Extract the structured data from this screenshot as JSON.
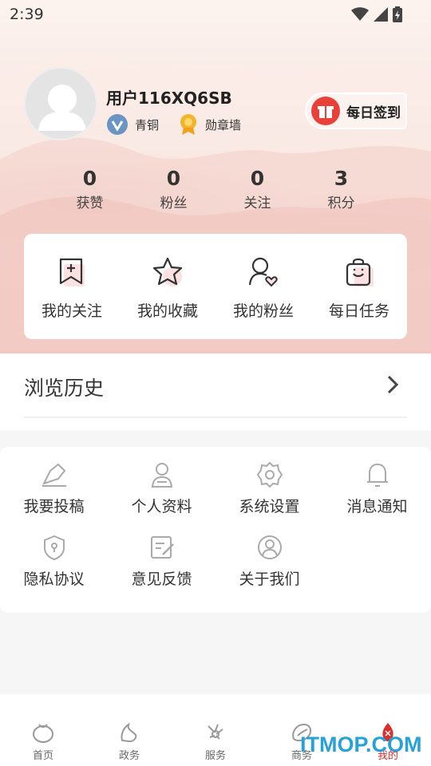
{
  "status_bar": {
    "time": "2:39",
    "icons": [
      "wifi-icon",
      "signal-icon",
      "battery-icon"
    ]
  },
  "profile": {
    "username": "用户116XQ6SB",
    "level": "青铜",
    "medal": "勋章墙",
    "checkin_label": "每日签到"
  },
  "stats": [
    {
      "value": "0",
      "label": "获赞"
    },
    {
      "value": "0",
      "label": "粉丝"
    },
    {
      "value": "0",
      "label": "关注"
    },
    {
      "value": "3",
      "label": "积分"
    }
  ],
  "quick_actions": [
    {
      "label": "我的关注",
      "icon": "bookmark-plus-icon"
    },
    {
      "label": "我的收藏",
      "icon": "star-icon"
    },
    {
      "label": "我的粉丝",
      "icon": "user-heart-icon"
    },
    {
      "label": "每日任务",
      "icon": "shopping-bag-icon"
    }
  ],
  "history": {
    "label": "浏览历史"
  },
  "settings": [
    {
      "label": "我要投稿",
      "icon": "edit-icon"
    },
    {
      "label": "个人资料",
      "icon": "user-icon"
    },
    {
      "label": "系统设置",
      "icon": "settings-icon"
    },
    {
      "label": "消息通知",
      "icon": "bell-icon"
    },
    {
      "label": "隐私协议",
      "icon": "shield-icon"
    },
    {
      "label": "意见反馈",
      "icon": "feedback-icon"
    },
    {
      "label": "关于我们",
      "icon": "about-icon"
    }
  ],
  "tabs": [
    {
      "label": "首页",
      "icon": "home-icon"
    },
    {
      "label": "政务",
      "icon": "gov-icon"
    },
    {
      "label": "服务",
      "icon": "service-icon"
    },
    {
      "label": "商务",
      "icon": "business-icon"
    },
    {
      "label": "我的",
      "icon": "mine-icon",
      "active": true
    }
  ],
  "watermark": "ITMOP.COM",
  "colors": {
    "accent": "#d9302c",
    "checkin": "#e8413a",
    "watermark": "#28a0d8"
  }
}
